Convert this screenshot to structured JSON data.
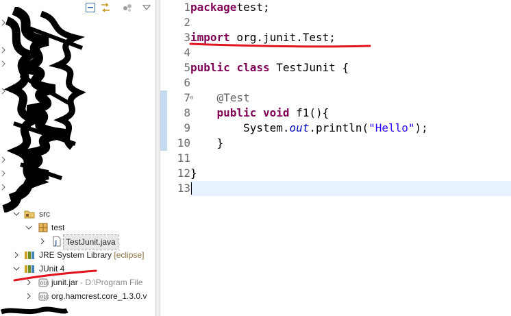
{
  "explorer": {
    "toolbar_icons": [
      "collapse-all-icon",
      "link-with-editor-icon",
      "view-menu-icon",
      "view-menu-dropdown-icon"
    ],
    "tree": [
      {
        "key": "src",
        "label": "src",
        "icon": "source-folder-icon",
        "expanded": true
      },
      {
        "key": "pkg",
        "label": "test",
        "icon": "package-icon",
        "expanded": true
      },
      {
        "key": "file",
        "label": "TestJunit.java",
        "icon": "java-file-icon",
        "expanded": false,
        "selected": true
      },
      {
        "key": "jre",
        "label": "JRE System Library",
        "decoration": "[eclipse]",
        "icon": "library-icon",
        "expanded": false
      },
      {
        "key": "junit",
        "label": "JUnit 4",
        "icon": "library-icon",
        "expanded": true
      },
      {
        "key": "jar1",
        "label": "junit.jar",
        "decoration": "- D:\\Program File",
        "icon": "jar-icon",
        "expanded": false
      },
      {
        "key": "jar2",
        "label": "org.hamcrest.core_1.3.0.v",
        "icon": "jar-icon",
        "expanded": false
      }
    ]
  },
  "editor": {
    "lines": [
      {
        "n": "1",
        "tokens": [
          [
            "kw",
            "package"
          ],
          [
            "",
            "test;"
          ]
        ]
      },
      {
        "n": "2",
        "tokens": []
      },
      {
        "n": "3",
        "tokens": [
          [
            "kw",
            "import"
          ],
          [
            "",
            " org.junit.Test;"
          ]
        ]
      },
      {
        "n": "4",
        "tokens": []
      },
      {
        "n": "5",
        "tokens": [
          [
            "kw",
            "public"
          ],
          [
            "",
            " "
          ],
          [
            "kw",
            "class"
          ],
          [
            "",
            " TestJunit {"
          ]
        ]
      },
      {
        "n": "6",
        "tokens": []
      },
      {
        "n": "7",
        "tokens": [
          [
            "",
            "    "
          ],
          [
            "ann",
            "@Test"
          ]
        ],
        "fold": "⊖"
      },
      {
        "n": "8",
        "tokens": [
          [
            "",
            "    "
          ],
          [
            "kw",
            "public"
          ],
          [
            "",
            " "
          ],
          [
            "kw",
            "void"
          ],
          [
            "",
            " f1(){"
          ]
        ]
      },
      {
        "n": "9",
        "tokens": [
          [
            "",
            "        System."
          ],
          [
            "fld",
            "out"
          ],
          [
            "",
            ".println("
          ],
          [
            "str",
            "\"Hello\""
          ],
          [
            "",
            ");"
          ]
        ]
      },
      {
        "n": "10",
        "tokens": [
          [
            "",
            "    }"
          ]
        ]
      },
      {
        "n": "11",
        "tokens": []
      },
      {
        "n": "12",
        "tokens": [
          [
            "",
            "}"
          ]
        ]
      },
      {
        "n": "13",
        "tokens": []
      }
    ],
    "current_line": "13"
  },
  "colors": {
    "keyword": "#7f0055",
    "annotation": "#646464",
    "string": "#2a00ff",
    "field": "#0000c0",
    "annotation_underline": "#e0151f",
    "current_line": "#e8f2fe",
    "change_ruler": "#c6dbee"
  }
}
